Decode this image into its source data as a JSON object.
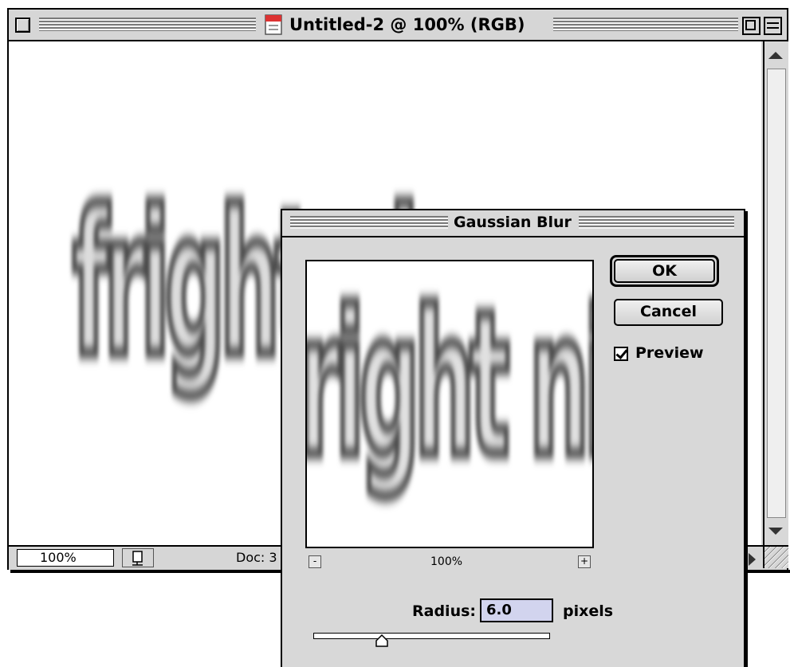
{
  "document_window": {
    "title": "Untitled-2 @ 100% (RGB)",
    "canvas_text": "fright nig",
    "status": {
      "zoom": "100%",
      "doc_info": "Doc: 3"
    }
  },
  "dialog": {
    "title": "Gaussian Blur",
    "preview_text": "right nig",
    "ok_label": "OK",
    "cancel_label": "Cancel",
    "preview_label": "Preview",
    "preview_checked": true,
    "preview_zoom": "100%",
    "zoom_out_label": "-",
    "zoom_in_label": "+",
    "radius_label": "Radius:",
    "radius_value": "6.0",
    "radius_unit": "pixels"
  },
  "colors": {
    "chrome": "#d6d6d6",
    "radius_field_bg": "#d2d4ee",
    "text": "#000000"
  },
  "icons": {
    "document_icon": "document-icon",
    "close_box": "close-box-icon",
    "zoom_box": "zoom-box-icon",
    "collapse_box": "collapse-box-icon"
  }
}
